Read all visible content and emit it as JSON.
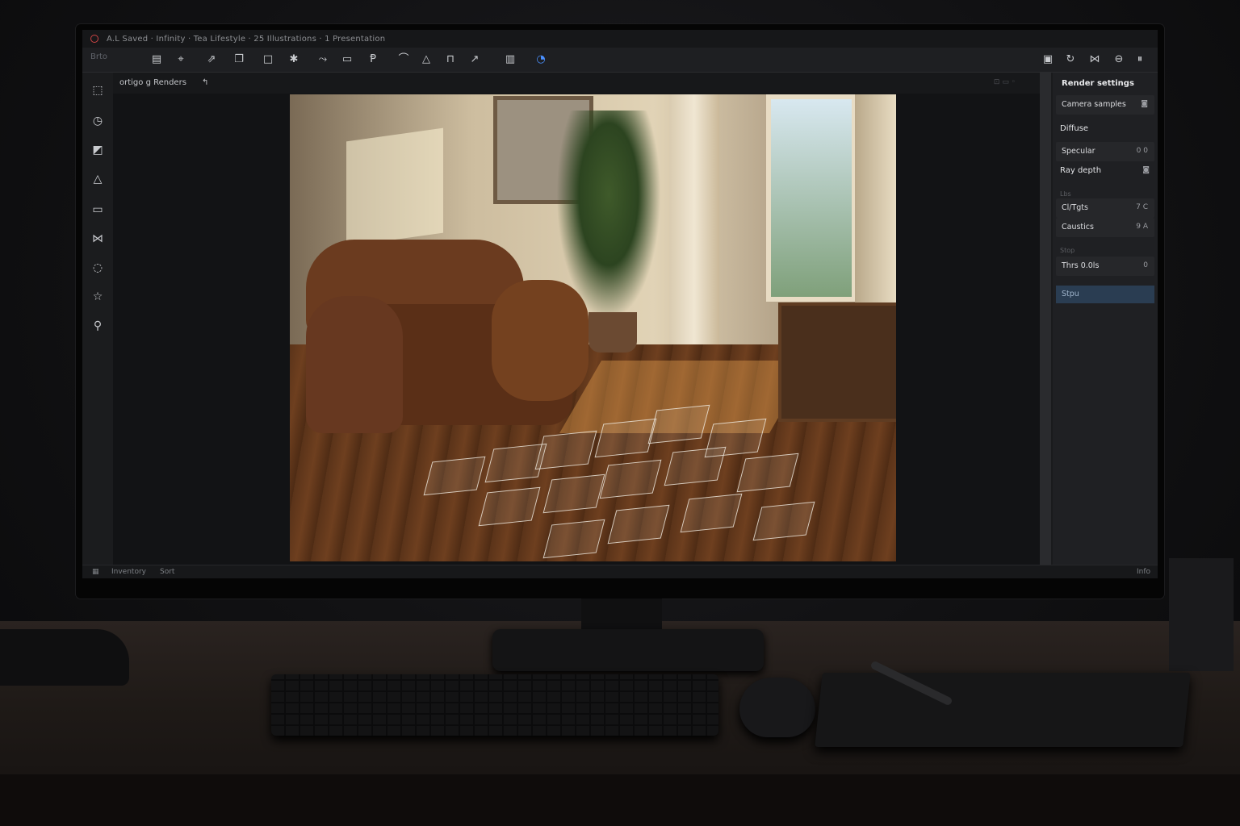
{
  "window": {
    "title": "A.L Saved · Infinity · Tea Lifestyle · 25 Illustrations · 1 Presentation",
    "close_color": "#cc4444"
  },
  "toolbar": {
    "mode_label": "Brto",
    "icons": [
      "folder-icon",
      "transform-icon",
      "share-icon",
      "copy-icon",
      "frame-icon",
      "pin-icon",
      "link-icon",
      "camera-icon",
      "light-icon",
      "mountain-icon",
      "measure-icon",
      "ruler-icon",
      "graph-icon",
      "chart-icon",
      "blender-icon",
      "save-icon",
      "cycle-icon",
      "node-icon",
      "minus-icon",
      "pause-icon"
    ]
  },
  "sidebar": {
    "icons": [
      "select-icon",
      "timer-icon",
      "image-icon",
      "warning-icon",
      "layer-icon",
      "curve-icon",
      "search-icon",
      "star-icon",
      "brush-icon"
    ]
  },
  "viewport": {
    "tab_label": "ortigo g Renders",
    "cursor_label": "↰",
    "tools_label": "⊡ ▭ ◦"
  },
  "render_settings": {
    "title": "Render settings",
    "camera_samples": "Camera samples",
    "diffuse": "Diffuse",
    "specular": "Specular",
    "specular_value": "0 0",
    "ray_depth": "Ray depth",
    "dim1": "Lbs",
    "clamp1": "Cl/Tgts",
    "clamp1_value": "7 C",
    "caustics": "Caustics",
    "caustics_value": "9 A",
    "dim2": "Stop",
    "threads": "Thrs 0.0ls",
    "threads_value": "0",
    "selected": "Stpu",
    "accent": "#2a3d52"
  },
  "status": {
    "left": "Inventory",
    "mid": "Sort",
    "right": "Info"
  }
}
